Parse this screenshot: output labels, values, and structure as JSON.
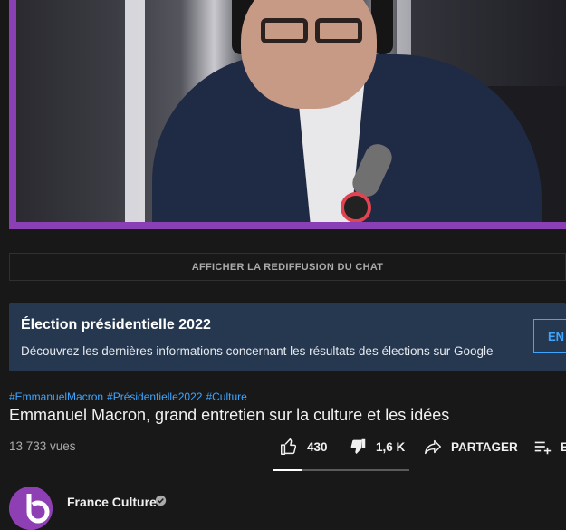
{
  "video": {
    "accent_border": "#8a3fb5"
  },
  "chat_replay": {
    "label": "AFFICHER LA REDIFFUSION DU CHAT"
  },
  "election_panel": {
    "title": "Élection présidentielle 2022",
    "description": "Découvrez les dernières informations concernant les résultats des élections sur Google",
    "button_label": "EN",
    "background": "#263850"
  },
  "hashtags": [
    "#EmmanuelMacron",
    "#Présidentielle2022",
    "#Culture"
  ],
  "title": "Emmanuel Macron, grand entretien sur la culture et les idées",
  "views": "13 733 vues",
  "actions": {
    "like_count": "430",
    "dislike_count": "1,6 K",
    "share_label": "PARTAGER",
    "save_label": "E",
    "like_icon": "thumbs-up-icon",
    "dislike_icon": "thumbs-down-icon",
    "share_icon": "share-arrow-icon",
    "save_icon": "playlist-add-icon"
  },
  "sentiment": {
    "like_ratio": 0.21
  },
  "channel": {
    "name": "France Culture",
    "verified": true,
    "avatar_color": "#8e3fb3"
  }
}
